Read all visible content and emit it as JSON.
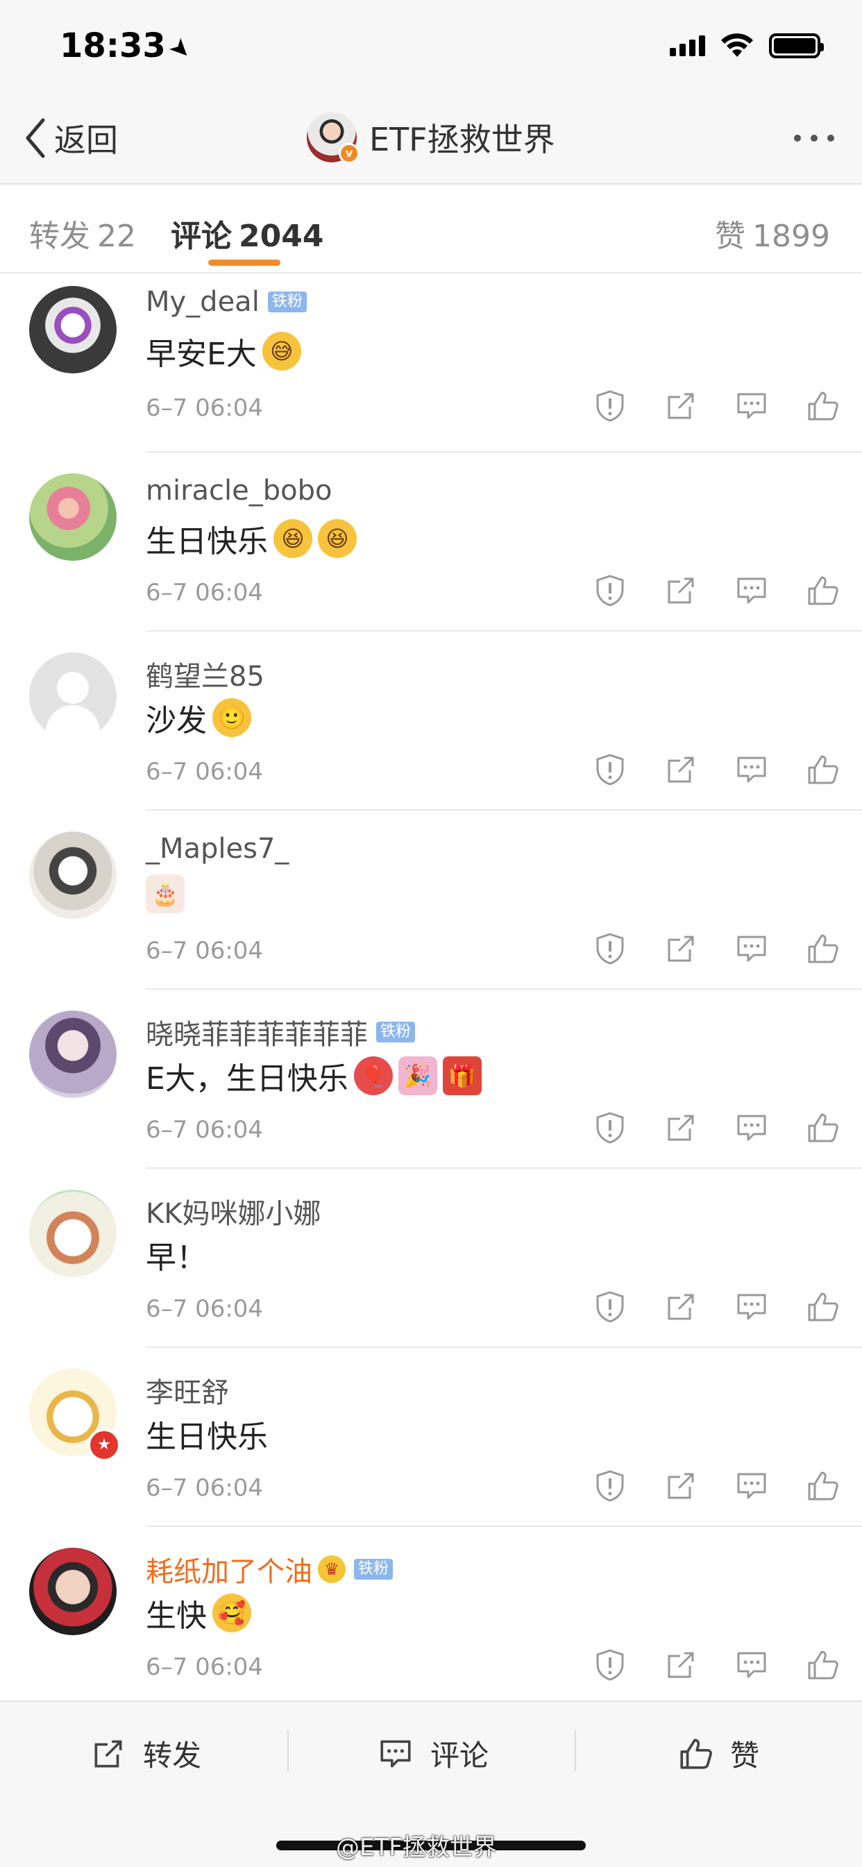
{
  "status_bar": {
    "time": "18:33"
  },
  "nav": {
    "back_label": "返回",
    "title": "ETF拯救世界"
  },
  "tabs": {
    "repost": {
      "label": "转发",
      "count": "22"
    },
    "comment": {
      "label": "评论",
      "count": "2044"
    },
    "like": {
      "label": "赞",
      "count": "1899"
    }
  },
  "comments": [
    {
      "user": "My_deal",
      "badge": "铁粉",
      "text": "早安E大",
      "emojis": [
        "😅"
      ],
      "time": "6–7 06:04"
    },
    {
      "user": "miracle_bobo",
      "badge": "",
      "text": "生日快乐",
      "emojis": [
        "😆",
        "😆"
      ],
      "time": "6–7 06:04"
    },
    {
      "user": "鹤望兰85",
      "badge": "",
      "text": "沙发",
      "emojis": [
        "🙂"
      ],
      "time": "6–7 06:04"
    },
    {
      "user": "_Maples7_",
      "badge": "",
      "text": "",
      "emojis": [
        "🎂"
      ],
      "time": "6–7 06:04"
    },
    {
      "user": "晓晓菲菲菲菲菲菲",
      "badge": "铁粉",
      "text": "E大，生日快乐",
      "emojis": [
        "🎈",
        "🎉",
        "🎁"
      ],
      "time": "6–7 06:04"
    },
    {
      "user": "KK妈咪娜小娜",
      "badge": "",
      "text": "早！",
      "emojis": [],
      "time": "6–7 06:04"
    },
    {
      "user": "李旺舒",
      "badge": "",
      "text": "生日快乐",
      "emojis": [],
      "time": "6–7 06:04"
    },
    {
      "user": "耗纸加了个油",
      "badge": "铁粉",
      "text": "生快",
      "emojis": [
        "🥰"
      ],
      "time": "6–7 06:04"
    }
  ],
  "bottom_bar": {
    "repost": "转发",
    "comment": "评论",
    "like": "赞"
  },
  "watermark": "@ETF拯救世界",
  "colors": {
    "accent": "#f08c2e",
    "orange_name": "#f06d1d",
    "fan_badge": "#8cb6ee"
  }
}
